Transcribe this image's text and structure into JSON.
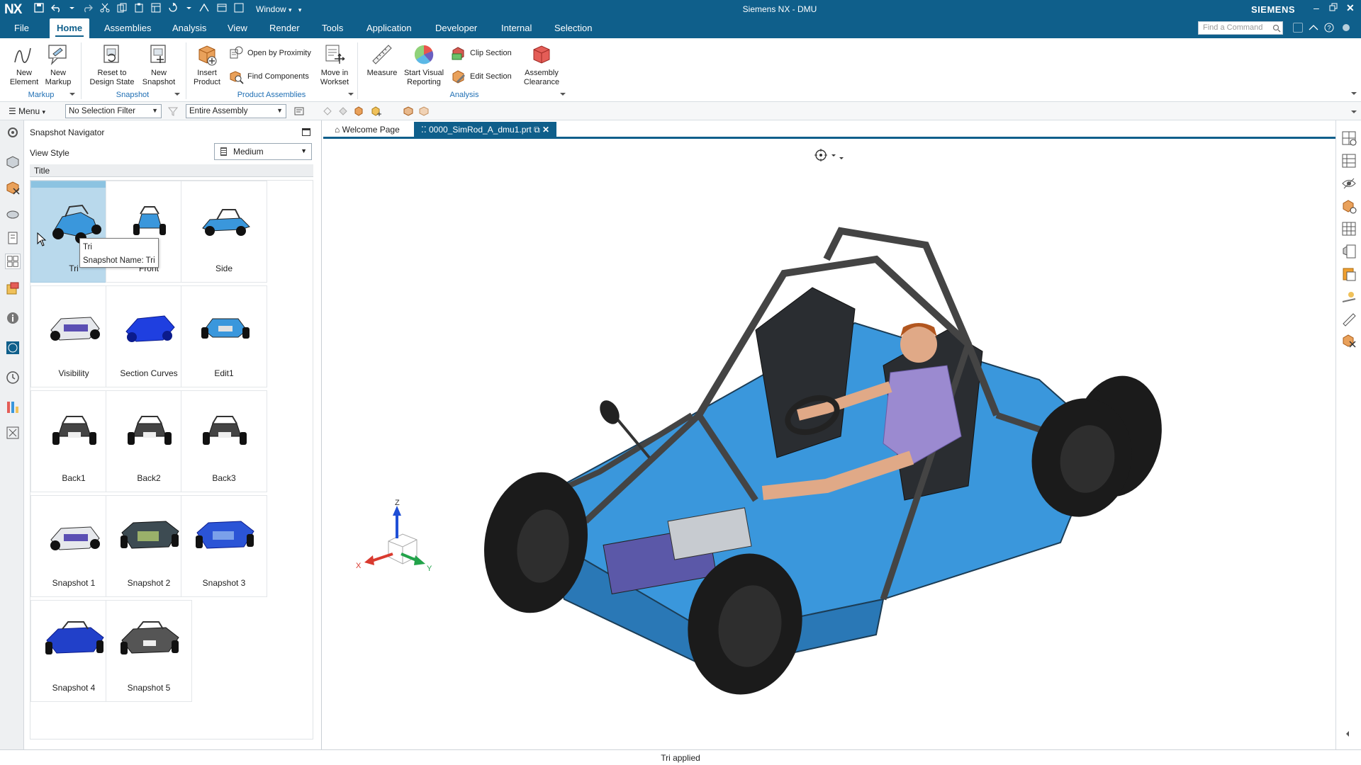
{
  "titlebar": {
    "logo": "NX",
    "window_label": "Window",
    "title": "Siemens NX - DMU",
    "brand": "SIEMENS"
  },
  "menu": {
    "tabs": [
      "File",
      "Home",
      "Assemblies",
      "Analysis",
      "View",
      "Render",
      "Tools",
      "Application",
      "Developer",
      "Internal",
      "Selection"
    ],
    "active": "Home",
    "find_placeholder": "Find a Command"
  },
  "ribbon": {
    "new_element": "New Element",
    "new_markup": "New Markup",
    "reset_design_state": "Reset to Design State",
    "new_snapshot": "New Snapshot",
    "insert_product": "Insert Product",
    "open_by_proximity": "Open by Proximity",
    "find_components": "Find Components",
    "move_in_workset": "Move in Workset",
    "measure": "Measure",
    "start_visual_reporting": "Start Visual Reporting",
    "clip_section": "Clip Section",
    "edit_section": "Edit Section",
    "assembly_clearance": "Assembly Clearance",
    "groups": {
      "markup": "Markup",
      "snapshot": "Snapshot",
      "product_assemblies": "Product Assemblies",
      "analysis": "Analysis"
    }
  },
  "toolbar": {
    "menu": "Menu",
    "selection_filter": "No Selection Filter",
    "scope": "Entire Assembly"
  },
  "navigator": {
    "title": "Snapshot Navigator",
    "view_style_label": "View Style",
    "view_style_value": "Medium",
    "column_title": "Title",
    "snapshots": [
      "Tri",
      "Front",
      "Side",
      "Visibility",
      "Section Curves",
      "Edit1",
      "Back1",
      "Back2",
      "Back3",
      "Snapshot 1",
      "Snapshot 2",
      "Snapshot 3",
      "Snapshot 4",
      "Snapshot 5"
    ],
    "selected": "Tri",
    "tooltip_title": "Tri",
    "tooltip_detail": "Snapshot Name: Tri"
  },
  "doc_tabs": {
    "welcome": "Welcome Page",
    "active_part": "0000_SimRod_A_dmu1.prt"
  },
  "triad": {
    "x": "X",
    "y": "Y",
    "z": "Z"
  },
  "status": "Tri applied",
  "colors": {
    "brand_blue": "#0f5f8b",
    "body_blue": "#3a97dc",
    "selection": "#b9d9ec",
    "group_label": "#1f6fb4"
  }
}
